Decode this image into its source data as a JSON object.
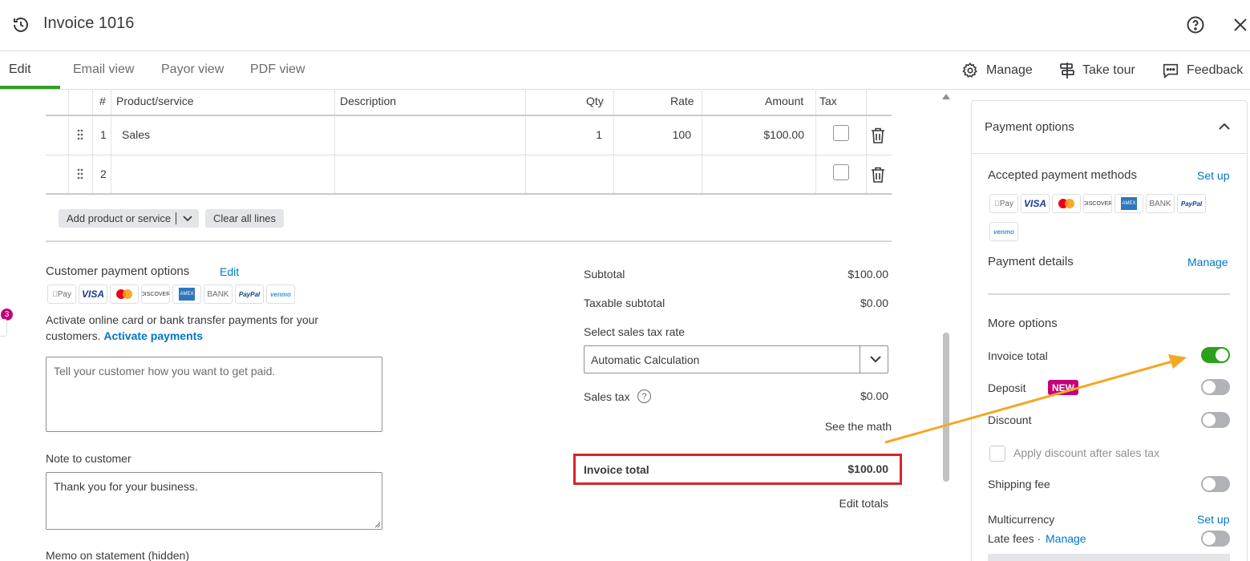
{
  "header": {
    "title": "Invoice 1016"
  },
  "tabs": [
    {
      "label": "Edit"
    },
    {
      "label": "Email view"
    },
    {
      "label": "Payor view"
    },
    {
      "label": "PDF view"
    }
  ],
  "toolbar": {
    "manage": "Manage",
    "take_tour": "Take tour",
    "feedback": "Feedback"
  },
  "table": {
    "headers": {
      "num": "#",
      "product": "Product/service",
      "description": "Description",
      "qty": "Qty",
      "rate": "Rate",
      "amount": "Amount",
      "tax": "Tax"
    },
    "rows": [
      {
        "num": "1",
        "product": "Sales",
        "description": "",
        "qty": "1",
        "rate": "100",
        "amount": "$100.00"
      },
      {
        "num": "2",
        "product": "",
        "description": "",
        "qty": "",
        "rate": "",
        "amount": ""
      }
    ],
    "add_product_label": "Add product or service",
    "clear_lines_label": "Clear all lines"
  },
  "customer_payment": {
    "title": "Customer payment options",
    "edit_link": "Edit",
    "methods": [
      "Pay",
      "VISA",
      "mastercard",
      "DISCOVER",
      "AMEX",
      "BANK",
      "PayPal",
      "venmo"
    ],
    "activate_text": "Activate online card or bank transfer payments for your customers.",
    "activate_link": "Activate payments",
    "instructions_placeholder": "Tell your customer how you want to get paid."
  },
  "note": {
    "label": "Note to customer",
    "value": "Thank you for your business."
  },
  "memo": {
    "label": "Memo on statement (hidden)"
  },
  "summary": {
    "subtotal_label": "Subtotal",
    "subtotal_value": "$100.00",
    "taxable_label": "Taxable subtotal",
    "taxable_value": "$0.00",
    "select_tax_label": "Select sales tax rate",
    "tax_rate_value": "Automatic Calculation",
    "sales_tax_label": "Sales tax",
    "sales_tax_value": "$0.00",
    "see_math_link": "See the math",
    "total_label": "Invoice total",
    "total_value": "$100.00",
    "edit_totals_link": "Edit totals"
  },
  "notification_count": "3",
  "panel": {
    "title": "Payment options",
    "accepted_title": "Accepted payment methods",
    "accepted_link": "Set up",
    "methods": [
      "Pay",
      "VISA",
      "mastercard",
      "DISCOVER",
      "AMEX",
      "BANK",
      "PayPal",
      "venmo"
    ],
    "details_title": "Payment details",
    "details_link": "Manage",
    "more_title": "More options",
    "options": {
      "invoice_total": {
        "label": "Invoice total",
        "on": true
      },
      "deposit": {
        "label": "Deposit",
        "badge": "NEW",
        "on": false
      },
      "discount": {
        "label": "Discount",
        "on": false
      },
      "apply_discount": {
        "label": "Apply discount after sales tax"
      },
      "shipping_fee": {
        "label": "Shipping fee",
        "on": false
      },
      "multicurrency": {
        "label": "Multicurrency",
        "link": "Set up"
      },
      "late_fees": {
        "label": "Late fees ·",
        "link": "Manage",
        "on": false
      }
    }
  },
  "colors": {
    "accent_green": "#2ca01c",
    "link_blue": "#0077c5",
    "highlight_red": "#d9232a",
    "arrow_orange": "#f5a623",
    "badge_magenta": "#c4007a"
  }
}
